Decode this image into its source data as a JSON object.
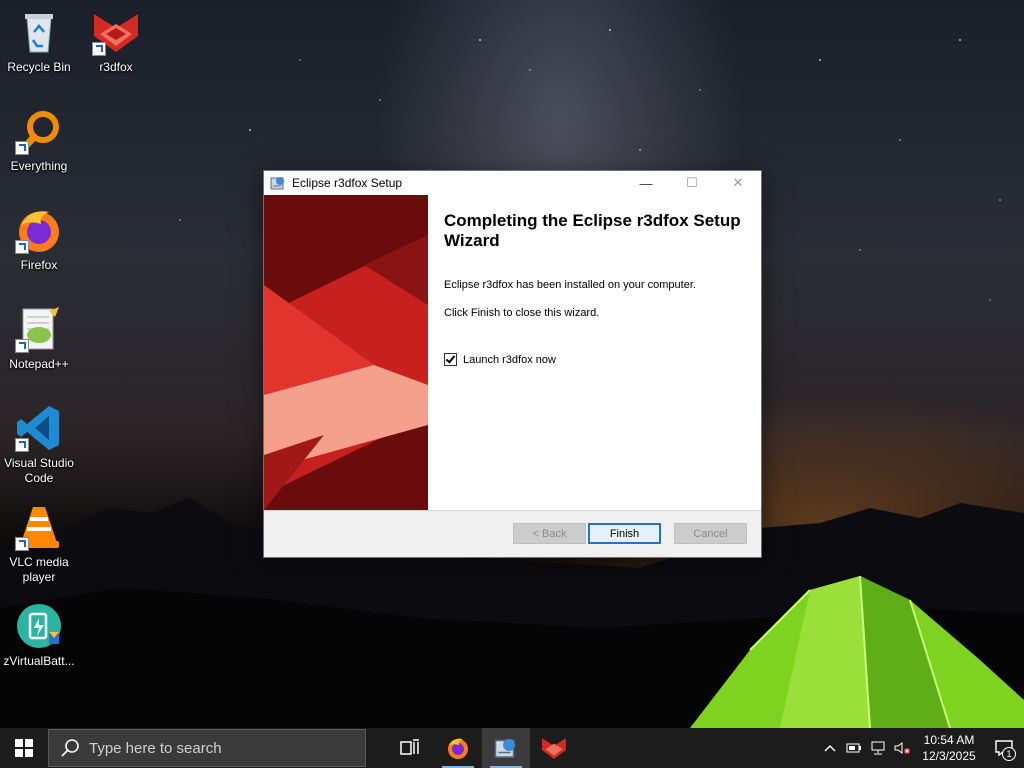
{
  "desktop": {
    "icons": [
      {
        "label": "Recycle Bin",
        "icon": "recycle-bin-icon"
      },
      {
        "label": "r3dfox",
        "icon": "r3dfox-icon"
      },
      {
        "label": "Everything",
        "icon": "everything-search-icon"
      },
      {
        "label": "Firefox",
        "icon": "firefox-icon"
      },
      {
        "label": "Notepad++",
        "icon": "notepad-plus-plus-icon"
      },
      {
        "label": "Visual Studio Code",
        "icon": "vscode-icon"
      },
      {
        "label": "VLC media player",
        "icon": "vlc-icon"
      },
      {
        "label": "zVirtualBatt...",
        "icon": "virtual-battery-icon"
      }
    ]
  },
  "dialog": {
    "title": "Eclipse r3dfox Setup",
    "heading": "Completing the Eclipse r3dfox Setup Wizard",
    "message_installed": "Eclipse r3dfox has been installed on your computer.",
    "message_close": "Click Finish to close this wizard.",
    "launch_checkbox": {
      "label": "Launch r3dfox now",
      "checked": true
    },
    "buttons": {
      "back": "< Back",
      "finish": "Finish",
      "cancel": "Cancel"
    },
    "titlebar_buttons": {
      "minimize": "—",
      "maximize": "☐",
      "close": "✕"
    }
  },
  "taskbar": {
    "search_placeholder": "Type here to search",
    "pinned": [
      "task-view-icon",
      "firefox-icon",
      "setup-installer-icon",
      "r3dfox-icon"
    ],
    "clock_time": "10:54 AM",
    "clock_date": "12/3/2025",
    "notification_count": "1"
  },
  "colors": {
    "accent": "#2a6fd0",
    "banner_red": "#c8201e",
    "taskbar": "#1c1c1c"
  }
}
